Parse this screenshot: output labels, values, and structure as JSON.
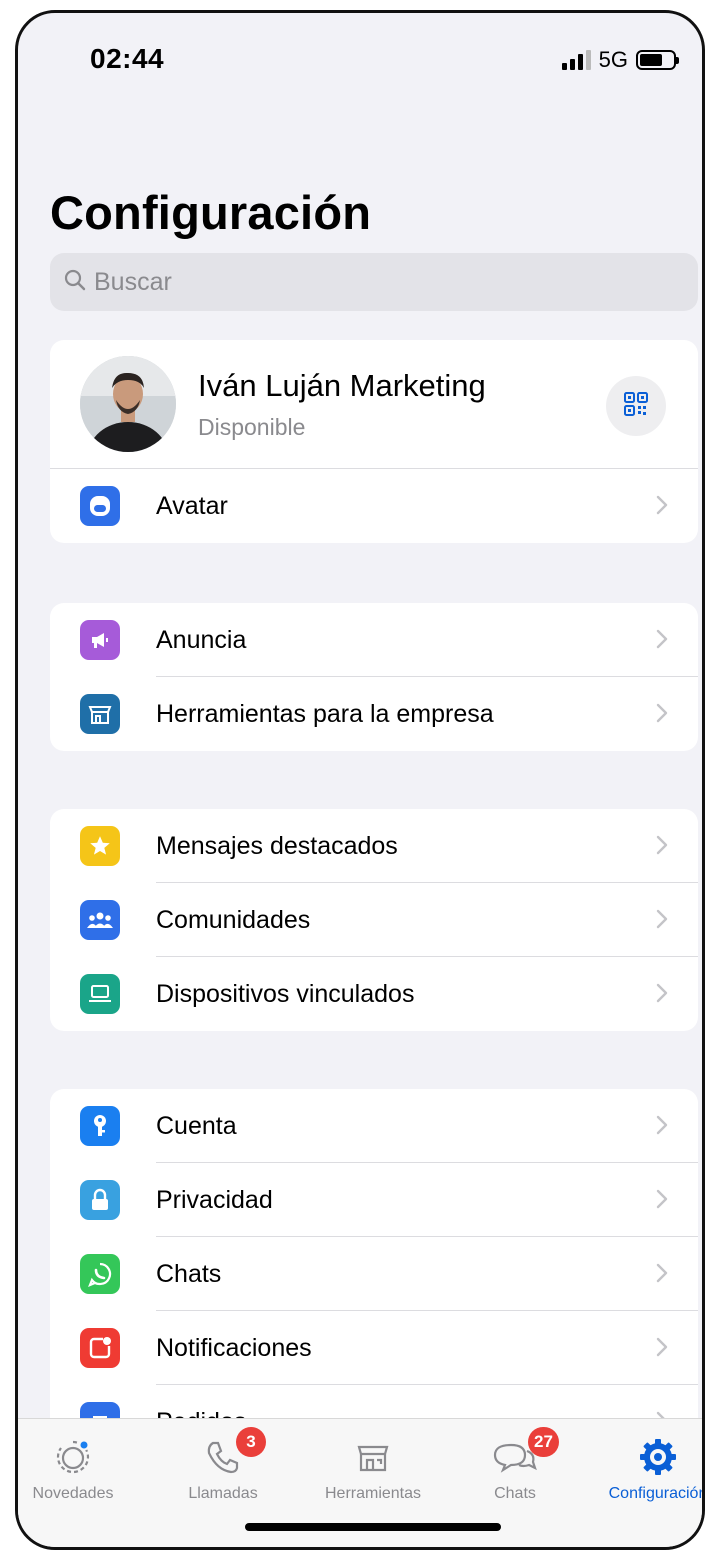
{
  "status_bar": {
    "time": "02:44",
    "network": "5G"
  },
  "header": {
    "title": "Configuración"
  },
  "search": {
    "placeholder": "Buscar"
  },
  "profile": {
    "name": "Iván Luján Marketing",
    "status": "Disponible"
  },
  "groups": [
    {
      "items": [
        {
          "label": "Avatar",
          "icon": "avatar-icon",
          "color": "#2f6fe8"
        }
      ]
    },
    {
      "items": [
        {
          "label": "Anuncia",
          "icon": "megaphone-icon",
          "color": "#a65bd9"
        },
        {
          "label": "Herramientas para la empresa",
          "icon": "store-icon",
          "color": "#1f6fa8"
        }
      ]
    },
    {
      "items": [
        {
          "label": "Mensajes destacados",
          "icon": "star-icon",
          "color": "#f5c518"
        },
        {
          "label": "Comunidades",
          "icon": "people-icon",
          "color": "#2f6fe8"
        },
        {
          "label": "Dispositivos vinculados",
          "icon": "laptop-icon",
          "color": "#1aa589"
        }
      ]
    },
    {
      "items": [
        {
          "label": "Cuenta",
          "icon": "key-icon",
          "color": "#1a7ff0"
        },
        {
          "label": "Privacidad",
          "icon": "lock-icon",
          "color": "#39a1e0"
        },
        {
          "label": "Chats",
          "icon": "whatsapp-icon",
          "color": "#34c759"
        },
        {
          "label": "Notificaciones",
          "icon": "notification-icon",
          "color": "#ef3b33"
        },
        {
          "label": "Pedidos",
          "icon": "orders-icon",
          "color": "#2f6fe8"
        }
      ]
    }
  ],
  "tabs": [
    {
      "label": "Novedades",
      "icon": "status-icon"
    },
    {
      "label": "Llamadas",
      "icon": "phone-icon",
      "badge": "3"
    },
    {
      "label": "Herramientas",
      "icon": "store-icon"
    },
    {
      "label": "Chats",
      "icon": "chat-bubbles-icon",
      "badge": "27"
    },
    {
      "label": "Configuración",
      "icon": "settings-gear-icon",
      "active": true
    }
  ],
  "colors": {
    "accent": "#0a5fd6",
    "badge": "#ea3f3a",
    "background": "#f2f2f7"
  }
}
